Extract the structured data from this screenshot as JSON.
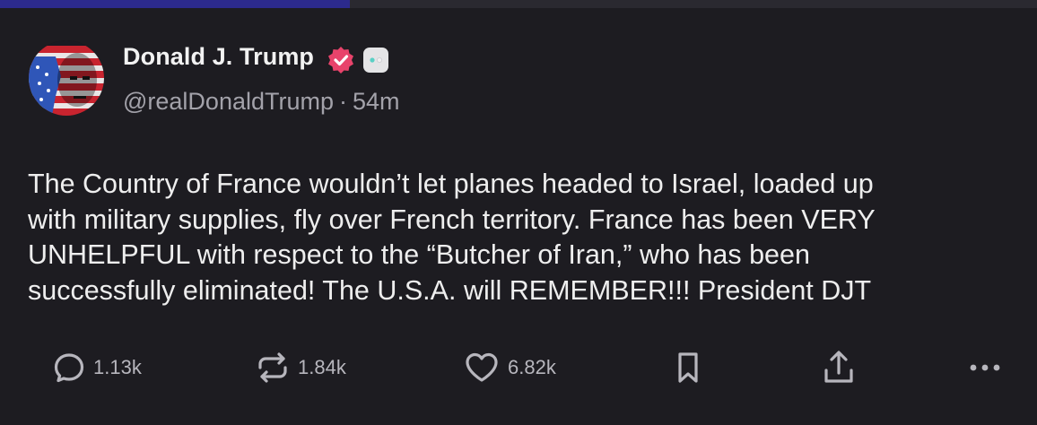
{
  "author": {
    "name": "Donald J. Trump",
    "handle": "@realDonaldTrump",
    "separator": "·",
    "time": "54m"
  },
  "post": {
    "lines": [
      "The Country of France wouldn’t let planes headed to Israel, loaded up",
      "with military supplies, fly over French territory. France has been VERY",
      "UNHELPFUL with respect to the “Butcher of Iran,” who has been",
      "successfully eliminated! The U.S.A. will REMEMBER!!! President DJT"
    ]
  },
  "actions": {
    "replies": "1.13k",
    "retruths": "1.84k",
    "likes": "6.82k"
  },
  "icons": {
    "verified": "verified-badge-icon",
    "badge": "truth-social-badge-icon",
    "reply": "speech-bubble-icon",
    "retruth": "repost-arrows-icon",
    "like": "heart-icon",
    "bookmark": "bookmark-icon",
    "share": "share-upload-icon",
    "more": "more-dots-icon"
  },
  "colors": {
    "background": "#1d1c21",
    "text": "#eeeeee",
    "muted": "#a3a2aa",
    "verified": "#e8436b",
    "progress": "#2c2a8c"
  },
  "progress_fraction": 0.337
}
